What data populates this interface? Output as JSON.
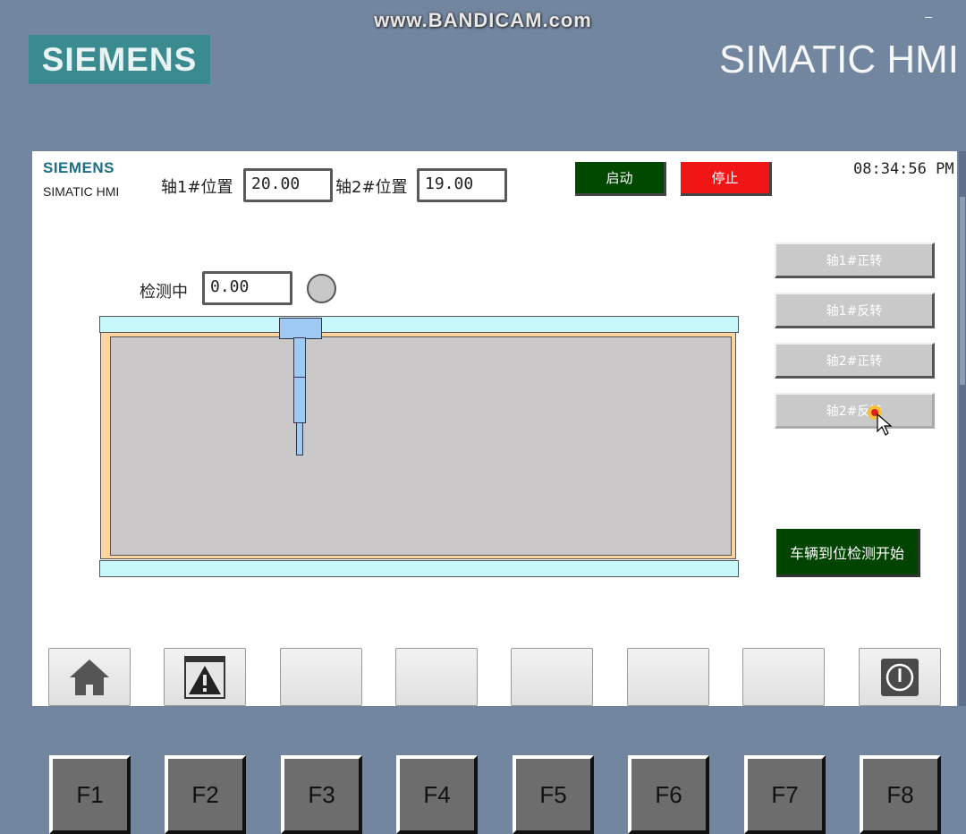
{
  "recording_overlay": {
    "watermark": "www.BANDICAM.com",
    "minimize": "–"
  },
  "bezel": {
    "brand": "SIEMENS",
    "model": "SIMATIC HMI"
  },
  "screen": {
    "logo": {
      "brand": "SIEMENS",
      "product": "SIMATIC HMI"
    },
    "axis1": {
      "label": "轴1#位置",
      "value": "20.00"
    },
    "axis2": {
      "label": "轴2#位置",
      "value": "19.00"
    },
    "start_button": "启动",
    "stop_button": "停止",
    "clock": "08:34:56 PM",
    "detection": {
      "label": "检测中",
      "value": "0.00",
      "lamp_color": "#c8c8c8"
    },
    "jog_buttons": [
      {
        "label": "轴1#正转"
      },
      {
        "label": "轴1#反转"
      },
      {
        "label": "轴2#正转"
      },
      {
        "label": "轴2#反转"
      }
    ],
    "vehicle_button": "车辆到位检测开始",
    "colors": {
      "start": "#004700",
      "stop": "#f21515",
      "vehicle": "#004400",
      "rail": "#c9f8fa",
      "frame": "#fdd5a1",
      "bay": "#cbc8ca",
      "probe": "#9fcaf3"
    },
    "screen_buttons": [
      {
        "icon": "home-icon"
      },
      {
        "icon": "alarm-warning-icon"
      },
      {
        "icon": ""
      },
      {
        "icon": ""
      },
      {
        "icon": ""
      },
      {
        "icon": ""
      },
      {
        "icon": ""
      },
      {
        "icon": "power-icon"
      }
    ]
  },
  "function_keys": [
    "F1",
    "F2",
    "F3",
    "F4",
    "F5",
    "F6",
    "F7",
    "F8"
  ]
}
